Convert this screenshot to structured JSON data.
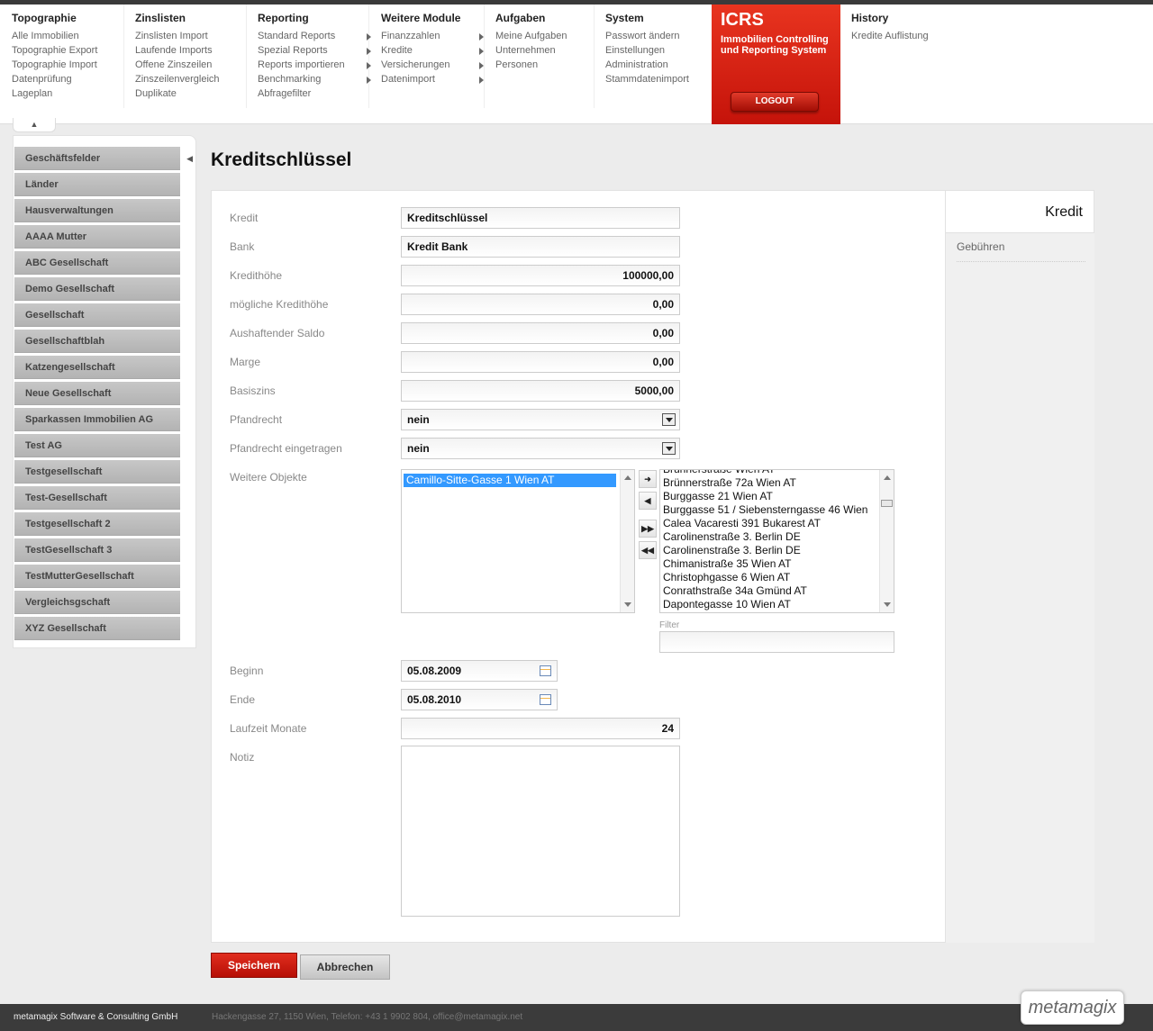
{
  "menu": [
    {
      "title": "Topographie",
      "items": [
        {
          "label": "Alle Immobilien"
        },
        {
          "label": "Topographie Export"
        },
        {
          "label": "Topographie Import"
        },
        {
          "label": "Datenprüfung"
        },
        {
          "label": "Lageplan"
        }
      ]
    },
    {
      "title": "Zinslisten",
      "items": [
        {
          "label": "Zinslisten Import"
        },
        {
          "label": "Laufende Imports"
        },
        {
          "label": "Offene Zinszeilen"
        },
        {
          "label": "Zinszeilenvergleich"
        },
        {
          "label": "Duplikate"
        }
      ]
    },
    {
      "title": "Reporting",
      "items": [
        {
          "label": "Standard Reports"
        },
        {
          "label": "Spezial Reports"
        },
        {
          "label": "Reports importieren"
        },
        {
          "label": "Benchmarking"
        },
        {
          "label": "Abfragefilter"
        }
      ]
    },
    {
      "title": "Weitere Module",
      "items": [
        {
          "label": "Finanzzahlen"
        },
        {
          "label": "Kredite"
        },
        {
          "label": "Versicherungen"
        },
        {
          "label": "Datenimport"
        }
      ]
    },
    {
      "title": "Aufgaben",
      "items": [
        {
          "label": "Meine Aufgaben"
        },
        {
          "label": "Unternehmen"
        },
        {
          "label": "Personen"
        }
      ]
    },
    {
      "title": "System",
      "items": [
        {
          "label": "Passwort ändern"
        },
        {
          "label": "Einstellungen"
        },
        {
          "label": "Administration"
        },
        {
          "label": "Stammdatenimport"
        }
      ]
    },
    {
      "title": "History",
      "items": [
        {
          "label": "Kredite Auflistung"
        }
      ]
    }
  ],
  "brand": {
    "name": "ICRS",
    "tagline": "Immobilien Controlling und Reporting System",
    "logout_label": "LOGOUT",
    "color": "#d2190b"
  },
  "sidebar": {
    "items": [
      "Geschäftsfelder",
      "Länder",
      "Hausverwaltungen",
      "AAAA Mutter",
      "ABC Gesellschaft",
      "Demo Gesellschaft",
      "Gesellschaft",
      "Gesellschaftblah",
      "Katzengesellschaft",
      "Neue Gesellschaft",
      "Sparkassen Immobilien AG",
      "Test AG",
      "Testgesellschaft",
      "Test-Gesellschaft",
      "Testgesellschaft 2",
      "TestGesellschaft 3",
      "TestMutterGesellschaft",
      "Vergleichsgschaft",
      "XYZ Gesellschaft"
    ]
  },
  "page": {
    "title": "Kreditschlüssel"
  },
  "form": {
    "kredit": {
      "label": "Kredit",
      "value": "Kreditschlüssel"
    },
    "bank": {
      "label": "Bank",
      "value": "Kredit Bank"
    },
    "kredithoehe": {
      "label": "Kredithöhe",
      "value": "100000,00"
    },
    "moegliche_kredithoehe": {
      "label": "mögliche Kredithöhe",
      "value": "0,00"
    },
    "aushaftender_saldo": {
      "label": "Aushaftender Saldo",
      "value": "0,00"
    },
    "marge": {
      "label": "Marge",
      "value": "0,00"
    },
    "basiszins": {
      "label": "Basiszins",
      "value": "5000,00"
    },
    "pfandrecht": {
      "label": "Pfandrecht",
      "value": "nein"
    },
    "pfandrecht_eingetragen": {
      "label": "Pfandrecht eingetragen",
      "value": "nein"
    },
    "weitere_objekte": {
      "label": "Weitere Objekte",
      "selected": [
        "Camillo-Sitte-Gasse 1 Wien AT"
      ],
      "available": [
        "Brünnerstraße Wien AT",
        "Brünnerstraße 72a Wien AT",
        "Burggasse 21 Wien AT",
        "Burggasse 51 / Siebensterngasse 46 Wien",
        "Calea Vacaresti 391 Bukarest AT",
        "Carolinenstraße 3. Berlin DE",
        "Carolinenstraße 3. Berlin DE",
        "Chimanistraße 35 Wien AT",
        "Christophgasse 6 Wien AT",
        "Conrathstraße 34a Gmünd AT",
        "Dapontegasse 10 Wien AT"
      ],
      "filter_label": "Filter",
      "filter_value": ""
    },
    "beginn": {
      "label": "Beginn",
      "value": "05.08.2009"
    },
    "ende": {
      "label": "Ende",
      "value": "05.08.2010"
    },
    "laufzeit": {
      "label": "Laufzeit Monate",
      "value": "24"
    },
    "notiz": {
      "label": "Notiz",
      "value": ""
    }
  },
  "tabs": {
    "kredit": "Kredit",
    "gebuehren": "Gebühren"
  },
  "actions": {
    "save": "Speichern",
    "cancel": "Abbrechen"
  },
  "footer": {
    "company": "metamagix Software & Consulting GmbH",
    "address": "Hackengasse 27, 1150 Wien, Telefon: +43 1 9902 804, office@metamagix.net",
    "logo": "metamagix"
  }
}
